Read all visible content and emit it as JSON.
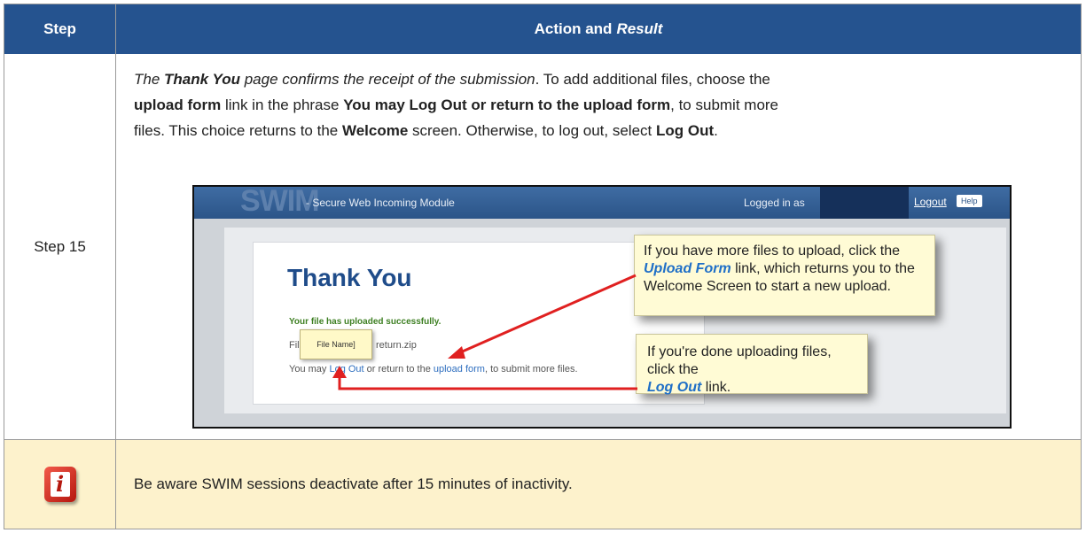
{
  "header": {
    "step_label": "Step",
    "action_label": "Action and",
    "result_label": "Result"
  },
  "step15": {
    "label": "Step 15",
    "text": {
      "l1_italic1": "The ",
      "l1_bold_italic": "Thank You",
      "l1_italic2": " page confirms the receipt of the submission",
      "l1_rest": ". To add additional files, choose the",
      "l2_bold1": "upload form",
      "l2_mid": " link in the phrase ",
      "l2_bold2": "You may Log Out or return to the upload form",
      "l2_end": ", to submit more",
      "l3_a": "files. This choice returns to the ",
      "l3_bold1": "Welcome",
      "l3_b": " screen. Otherwise, to log out, select ",
      "l3_bold2": "Log Out",
      "l3_end": "."
    },
    "screenshot": {
      "logo": "SWIM",
      "subtitle": "- Secure Web Incoming Module",
      "logged_in": "Logged in as",
      "logout": "Logout",
      "help": "Help",
      "thank_you": "Thank You",
      "success": "Your file has uploaded successfully.",
      "file_label": "File:",
      "file_name": "File Name]",
      "file_suffix": "return.zip",
      "may_1": "You may ",
      "may_logout": "Log Out",
      "may_2": " or return to the ",
      "may_upload": "upload form",
      "may_3": ", to submit more files.",
      "callout1_a": "If you have more files to upload, click the",
      "callout1_link": "Upload Form",
      "callout1_b": " link, which returns you to the",
      "callout1_c": "Welcome Screen to start a new upload.",
      "callout2_a": "If you're done uploading files, click the",
      "callout2_link": "Log Out",
      "callout2_b": " link."
    }
  },
  "note": {
    "icon": "info-icon",
    "text": "Be aware SWIM sessions deactivate after 15 minutes of inactivity."
  },
  "colors": {
    "header_bg": "#25538f",
    "note_bg": "#fdf2cc",
    "arrow": "#e02020"
  }
}
